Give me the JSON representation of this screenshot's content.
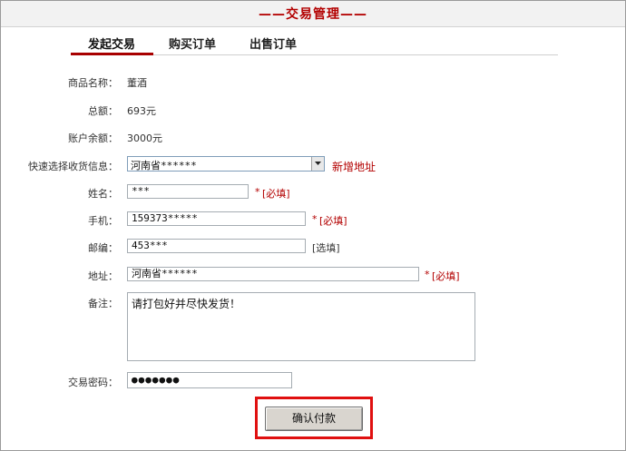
{
  "header": {
    "title": "——交易管理——"
  },
  "tabs": [
    {
      "label": "发起交易",
      "active": true
    },
    {
      "label": "购买订单",
      "active": false
    },
    {
      "label": "出售订单",
      "active": false
    }
  ],
  "form": {
    "product_name_label": "商品名称：",
    "product_name": "董酒",
    "total_label": "总额：",
    "total": "693元",
    "balance_label": "账户余额：",
    "balance": "3000元",
    "quick_address_label": "快速选择收货信息：",
    "quick_address_value": "河南省******",
    "add_address_link": "新增地址",
    "name_label": "姓名：",
    "name_value": "***",
    "phone_label": "手机：",
    "phone_value": "159373*****",
    "zip_label": "邮编：",
    "zip_value": "453***",
    "zip_hint": "[选填]",
    "address_label": "地址：",
    "address_value": "河南省******",
    "required_mark": "*",
    "required_hint": "[必填]",
    "note_label": "备注：",
    "note_value": "请打包好并尽快发货！",
    "password_label": "交易密码：",
    "password_value": "●●●●●●●",
    "confirm_button": "确认付款"
  },
  "colors": {
    "accent": "#b30000",
    "highlight": "#e01010"
  }
}
